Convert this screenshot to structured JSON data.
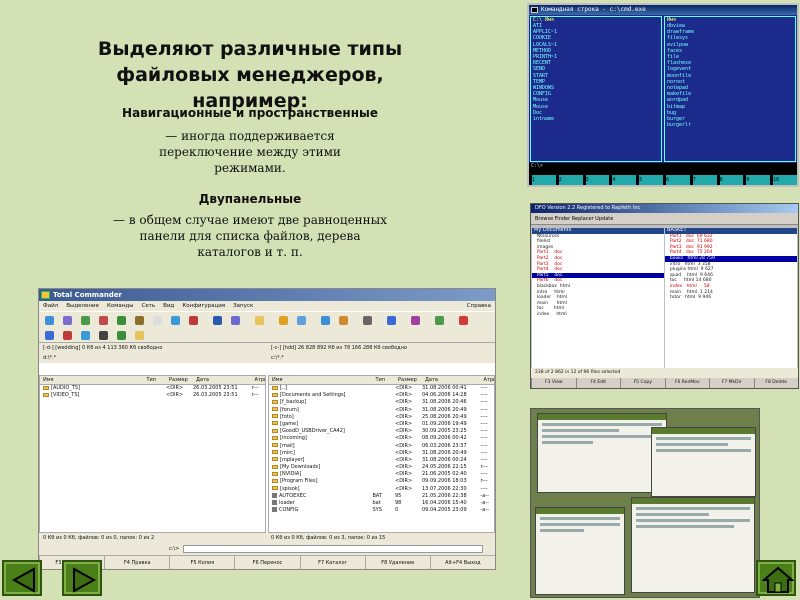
{
  "slide": {
    "title": "Выделяют различные типы файловых менеджеров, например:",
    "section1": {
      "title": "Навигационные и пространственные",
      "body": "— иногда поддерживается переключение между этими режимами."
    },
    "section2": {
      "title": "Двупанельные",
      "body": "— в общем случае имеют две равноценных панели для списка файлов, дерева каталогов и т. п."
    }
  },
  "far": {
    "window_title": "Командная строка - c:\\cmd.exe",
    "left_header": "C:\\ Имя",
    "right_header": "Имя",
    "left_files": "ATI\nAPPLIC~1\nCOOKIE\nLOCALS~1\nMETHOD\nPRINTH~1\nRECENT\nSEND\nSTART\nTEMP\nWINDOWS\nCONFIG\nMouse\nMouse\nDoc\nintname",
    "right_files": "dbview\ndrawframe\nfilesys\nevilpow\nfaces\nfile\nflashexe\nlogevent\nmoonfile\nnoroot\nnotepad\nmakefile\nwordpad\nbitmap\nbug\nburger\nburgerlr",
    "cmdline": "C:\\>",
    "keys": [
      "1",
      "2",
      "3",
      "4",
      "5",
      "6",
      "7",
      "8",
      "9",
      "10"
    ]
  },
  "dn": {
    "window_title": "DFO Version 2.2 Registered to Rapfeth Inc",
    "toolbar": "Browse   Finder   Replacer   Update",
    "left_header": "My Documents",
    "right_header": "BASKET",
    "status": "238 of 2 862 in 12 of 96 files selected",
    "fkeys": [
      "F3 View",
      "F4 Edit",
      "F5 Copy",
      "F6 RenMov",
      "F7 MkDir",
      "F8 Delete"
    ]
  },
  "tc": {
    "window_title": "Total Commander",
    "menu": [
      "Файл",
      "Выделение",
      "Команды",
      "Сеть",
      "Вид",
      "Конфигурация",
      "Запуск"
    ],
    "help": "Справка",
    "left_drive": "[-d-] [wedding] 0 Кб из 4 113 360 Кб свободно",
    "right_drive": "[-c-] [hdd] 26 828 892 Кб из 78 166 288 Кб свободно",
    "left_path": "d:\\*.*",
    "right_path": "c:\\*.*",
    "columns": [
      "Имя",
      "Тип",
      "Размер",
      "Дата",
      "Атрибуты"
    ],
    "left_rows": [
      {
        "name": "[AUDIO_TS]",
        "ext": "",
        "size": "<DIR>",
        "date": "26.03.2005 23:51",
        "attr": "r---"
      },
      {
        "name": "[VIDEO_TS]",
        "ext": "",
        "size": "<DIR>",
        "date": "26.03.2005 23:51",
        "attr": "r---"
      }
    ],
    "right_rows": [
      {
        "name": "[..]",
        "ext": "",
        "size": "<DIR>",
        "date": "31.08.2006 00:41",
        "attr": "----"
      },
      {
        "name": "[Documents and Settings]",
        "ext": "",
        "size": "<DIR>",
        "date": "04.06.2006 14:28",
        "attr": "----"
      },
      {
        "name": "[f_backup]",
        "ext": "",
        "size": "<DIR>",
        "date": "31.08.2006 20:46",
        "attr": "----"
      },
      {
        "name": "[forum]",
        "ext": "",
        "size": "<DIR>",
        "date": "31.08.2006 20:49",
        "attr": "----"
      },
      {
        "name": "[foto]",
        "ext": "",
        "size": "<DIR>",
        "date": "25.08.2006 20:49",
        "attr": "----"
      },
      {
        "name": "[game]",
        "ext": "",
        "size": "<DIR>",
        "date": "01.09.2006 19:49",
        "attr": "----"
      },
      {
        "name": "[GoodD_USBDriver_CA42]",
        "ext": "",
        "size": "<DIR>",
        "date": "30.09.2005 23:25",
        "attr": "----"
      },
      {
        "name": "[incoming]",
        "ext": "",
        "size": "<DIR>",
        "date": "08.09.2006 00:42",
        "attr": "----"
      },
      {
        "name": "[mail]",
        "ext": "",
        "size": "<DIR>",
        "date": "06.03.2006 23:37",
        "attr": "----"
      },
      {
        "name": "[mirc]",
        "ext": "",
        "size": "<DIR>",
        "date": "31.08.2006 20:49",
        "attr": "----"
      },
      {
        "name": "[mplayer]",
        "ext": "",
        "size": "<DIR>",
        "date": "31.08.2006 00:24",
        "attr": "----"
      },
      {
        "name": "[My Downloads]",
        "ext": "",
        "size": "<DIR>",
        "date": "24.05.2006 22:15",
        "attr": "r---"
      },
      {
        "name": "[NVIDIA]",
        "ext": "",
        "size": "<DIR>",
        "date": "21.06.2005 02:40",
        "attr": "----"
      },
      {
        "name": "[Program Files]",
        "ext": "",
        "size": "<DIR>",
        "date": "09.09.2006 18:03",
        "attr": "r---"
      },
      {
        "name": "[spisok]",
        "ext": "",
        "size": "<DIR>",
        "date": "13.07.2006 22:30",
        "attr": "----"
      },
      {
        "name": "AUTOEXEC",
        "ext": "BAT",
        "size": "95",
        "date": "21.05.2006 22:38",
        "attr": "-a--"
      },
      {
        "name": "loader",
        "ext": "bat",
        "size": "98",
        "date": "16.04.2006 15:40",
        "attr": "-a--"
      },
      {
        "name": "CONFIG",
        "ext": "SYS",
        "size": "0",
        "date": "09.04.2005 23:09",
        "attr": "-a--"
      }
    ],
    "left_status": "0 Кб из 0 Кб, файлов: 0 из 0, папок: 0 из 2",
    "right_status": "0 Кб из 0 Кб, файлов: 0 из 3, папок: 0 из 15",
    "cmd_label": "c:\\>",
    "fkeys": [
      "F3 Просмотр",
      "F4 Правка",
      "F5 Копия",
      "F6 Перенос",
      "F7 Каталог",
      "F8 Удаление",
      "Alt+F4 Выход"
    ]
  },
  "nav": {
    "prev_icon": "arrow-left-icon",
    "next_icon": "arrow-right-icon",
    "home_icon": "home-icon"
  }
}
